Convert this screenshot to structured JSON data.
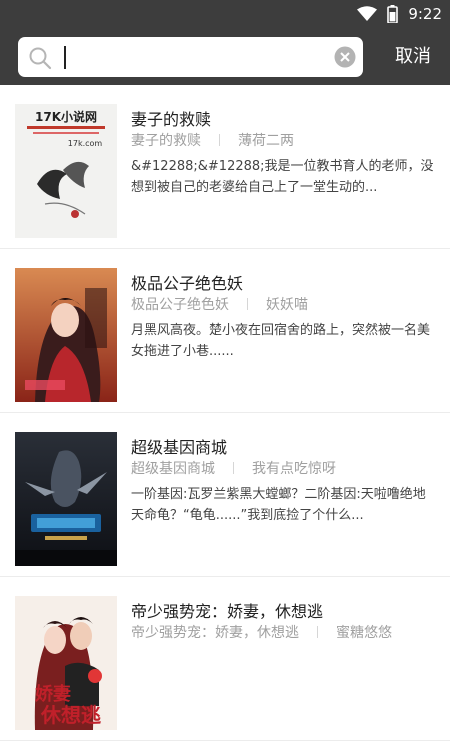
{
  "status_bar": {
    "time": "9:22",
    "icons": [
      "wifi-icon",
      "battery-icon"
    ]
  },
  "search": {
    "value": "",
    "icons": [
      "search-icon",
      "clear-icon"
    ],
    "cancel_label": "取消"
  },
  "colors": {
    "header_bg": "#3d3d3d",
    "title_text": "#222222",
    "meta_text": "#a0a0a0"
  },
  "results": [
    {
      "title": "妻子的救赎",
      "meta_title": "妻子的救赎",
      "author": "薄荷二两",
      "description": "&#12288;&#12288;我是一位教书育人的老师，没想到被自己的老婆给自己上了一堂生动的...",
      "cover_text": [
        "17K小说网",
        "17k.com"
      ]
    },
    {
      "title": "极品公子绝色妖",
      "meta_title": "极品公子绝色妖",
      "author": "妖妖喵",
      "description": "月黑风高夜。楚小夜在回宿舍的路上，突然被一名美女拖进了小巷......",
      "cover_text": []
    },
    {
      "title": "超级基因商城",
      "meta_title": "超级基因商城",
      "author": "我有点吃惊呀",
      "description": "一阶基因:瓦罗兰紫黑大螳螂？二阶基因:天啦噜绝地天命龟？“龟龟......”我到底捡了个什么...",
      "cover_text": []
    },
    {
      "title": "帝少强势宠：娇妻，休想逃",
      "meta_title": "帝少强势宠：娇妻，休想逃",
      "author": "蜜糖悠悠",
      "description": "",
      "cover_text": [
        "娇妻",
        "休想逃"
      ]
    }
  ]
}
